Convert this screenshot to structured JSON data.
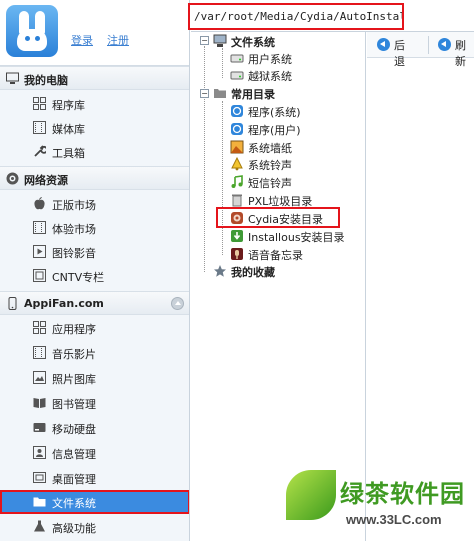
{
  "header": {
    "login_label": "登录",
    "register_label": "注册"
  },
  "address_bar": {
    "path": "/var/root/Media/Cydia/AutoInstall"
  },
  "sidebar": {
    "sections": [
      {
        "label": "我的电脑",
        "icon": "monitor-icon"
      },
      {
        "label": "网络资源",
        "icon": "globe-icon"
      },
      {
        "label": "AppiFan.com",
        "icon": "phone-icon"
      }
    ],
    "my_computer_items": [
      {
        "label": "程序库",
        "icon": "grid-icon"
      },
      {
        "label": "媒体库",
        "icon": "film-icon"
      },
      {
        "label": "工具箱",
        "icon": "wrench-icon"
      }
    ],
    "network_items": [
      {
        "label": "正版市场",
        "icon": "apple-icon"
      },
      {
        "label": "体验市场",
        "icon": "film-icon"
      },
      {
        "label": "图铃影音",
        "icon": "media-icon"
      },
      {
        "label": "CNTV专栏",
        "icon": "tv-icon"
      }
    ],
    "device_items": [
      {
        "label": "应用程序",
        "icon": "grid-icon"
      },
      {
        "label": "音乐影片",
        "icon": "film-icon"
      },
      {
        "label": "照片图库",
        "icon": "photo-icon"
      },
      {
        "label": "图书管理",
        "icon": "book-icon"
      },
      {
        "label": "移动硬盘",
        "icon": "disk-icon"
      },
      {
        "label": "信息管理",
        "icon": "contact-icon"
      },
      {
        "label": "桌面管理",
        "icon": "desktop-icon"
      },
      {
        "label": "文件系统",
        "icon": "folder-icon",
        "active": true
      },
      {
        "label": "高级功能",
        "icon": "flask-icon"
      }
    ]
  },
  "tree": {
    "file_system": {
      "label": "文件系统",
      "children": [
        "用户系统",
        "越狱系统"
      ]
    },
    "common_dirs": {
      "label": "常用目录",
      "children": [
        "程序(系统)",
        "程序(用户)",
        "系统墙纸",
        "系统铃声",
        "短信铃声",
        "PXL垃圾目录",
        "Cydia安装目录",
        "Installous安装目录",
        "语音备忘录"
      ]
    },
    "favorites": {
      "label": "我的收藏"
    }
  },
  "toolbar": {
    "back_label": "后退",
    "refresh_label": "刷新"
  },
  "watermark": {
    "title": "绿茶软件园",
    "url": "www.33LC.com"
  },
  "colors": {
    "accent": "#3b8be0",
    "highlight_border": "#e4141b",
    "link": "#3b7fd1"
  }
}
